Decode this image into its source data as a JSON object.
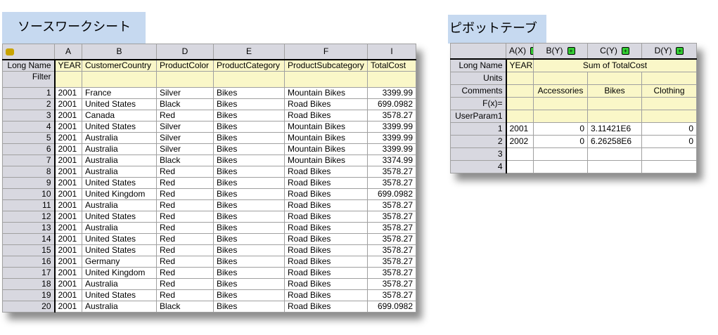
{
  "source": {
    "title": "ソースワークシート",
    "columns": [
      "A",
      "B",
      "D",
      "E",
      "F",
      "I"
    ],
    "long_names": [
      "YEAR",
      "CustomerCountry",
      "ProductColor",
      "ProductCategory",
      "ProductSubcategory",
      "TotalCost"
    ],
    "label_rows": [
      "Long Name",
      "Filter"
    ],
    "rows": [
      [
        "2001",
        "France",
        "Silver",
        "Bikes",
        "Mountain Bikes",
        "3399.99"
      ],
      [
        "2001",
        "United States",
        "Black",
        "Bikes",
        "Road Bikes",
        "699.0982"
      ],
      [
        "2001",
        "Canada",
        "Red",
        "Bikes",
        "Road Bikes",
        "3578.27"
      ],
      [
        "2001",
        "United States",
        "Silver",
        "Bikes",
        "Mountain Bikes",
        "3399.99"
      ],
      [
        "2001",
        "Australia",
        "Silver",
        "Bikes",
        "Mountain Bikes",
        "3399.99"
      ],
      [
        "2001",
        "Australia",
        "Silver",
        "Bikes",
        "Mountain Bikes",
        "3399.99"
      ],
      [
        "2001",
        "Australia",
        "Black",
        "Bikes",
        "Mountain Bikes",
        "3374.99"
      ],
      [
        "2001",
        "Australia",
        "Red",
        "Bikes",
        "Road Bikes",
        "3578.27"
      ],
      [
        "2001",
        "United States",
        "Red",
        "Bikes",
        "Road Bikes",
        "3578.27"
      ],
      [
        "2001",
        "United Kingdom",
        "Red",
        "Bikes",
        "Road Bikes",
        "699.0982"
      ],
      [
        "2001",
        "Australia",
        "Red",
        "Bikes",
        "Road Bikes",
        "3578.27"
      ],
      [
        "2001",
        "United States",
        "Red",
        "Bikes",
        "Road Bikes",
        "3578.27"
      ],
      [
        "2001",
        "Australia",
        "Red",
        "Bikes",
        "Road Bikes",
        "3578.27"
      ],
      [
        "2001",
        "United States",
        "Red",
        "Bikes",
        "Road Bikes",
        "3578.27"
      ],
      [
        "2001",
        "United States",
        "Red",
        "Bikes",
        "Road Bikes",
        "3578.27"
      ],
      [
        "2001",
        "Germany",
        "Red",
        "Bikes",
        "Road Bikes",
        "3578.27"
      ],
      [
        "2001",
        "United Kingdom",
        "Red",
        "Bikes",
        "Road Bikes",
        "3578.27"
      ],
      [
        "2001",
        "Australia",
        "Red",
        "Bikes",
        "Road Bikes",
        "3578.27"
      ],
      [
        "2001",
        "United States",
        "Red",
        "Bikes",
        "Road Bikes",
        "3578.27"
      ],
      [
        "2001",
        "Australia",
        "Black",
        "Bikes",
        "Road Bikes",
        "699.0982"
      ]
    ]
  },
  "pivot": {
    "title": "ピボットテーブル",
    "columns": [
      "A(X)",
      "B(Y)",
      "C(Y)",
      "D(Y)"
    ],
    "label_rows": [
      "Long Name",
      "Units",
      "Comments",
      "F(x)=",
      "UserParam1"
    ],
    "long_name_year": "YEAR",
    "long_name_sum": "Sum of TotalCost",
    "comments": [
      "",
      "Accessories",
      "Bikes",
      "Clothing"
    ],
    "rows": [
      [
        "2001",
        "0",
        "3.11421E6",
        "0"
      ],
      [
        "2002",
        "0",
        "6.26258E6",
        "0"
      ],
      [
        "",
        "",
        "",
        ""
      ],
      [
        "",
        "",
        "",
        ""
      ]
    ]
  }
}
